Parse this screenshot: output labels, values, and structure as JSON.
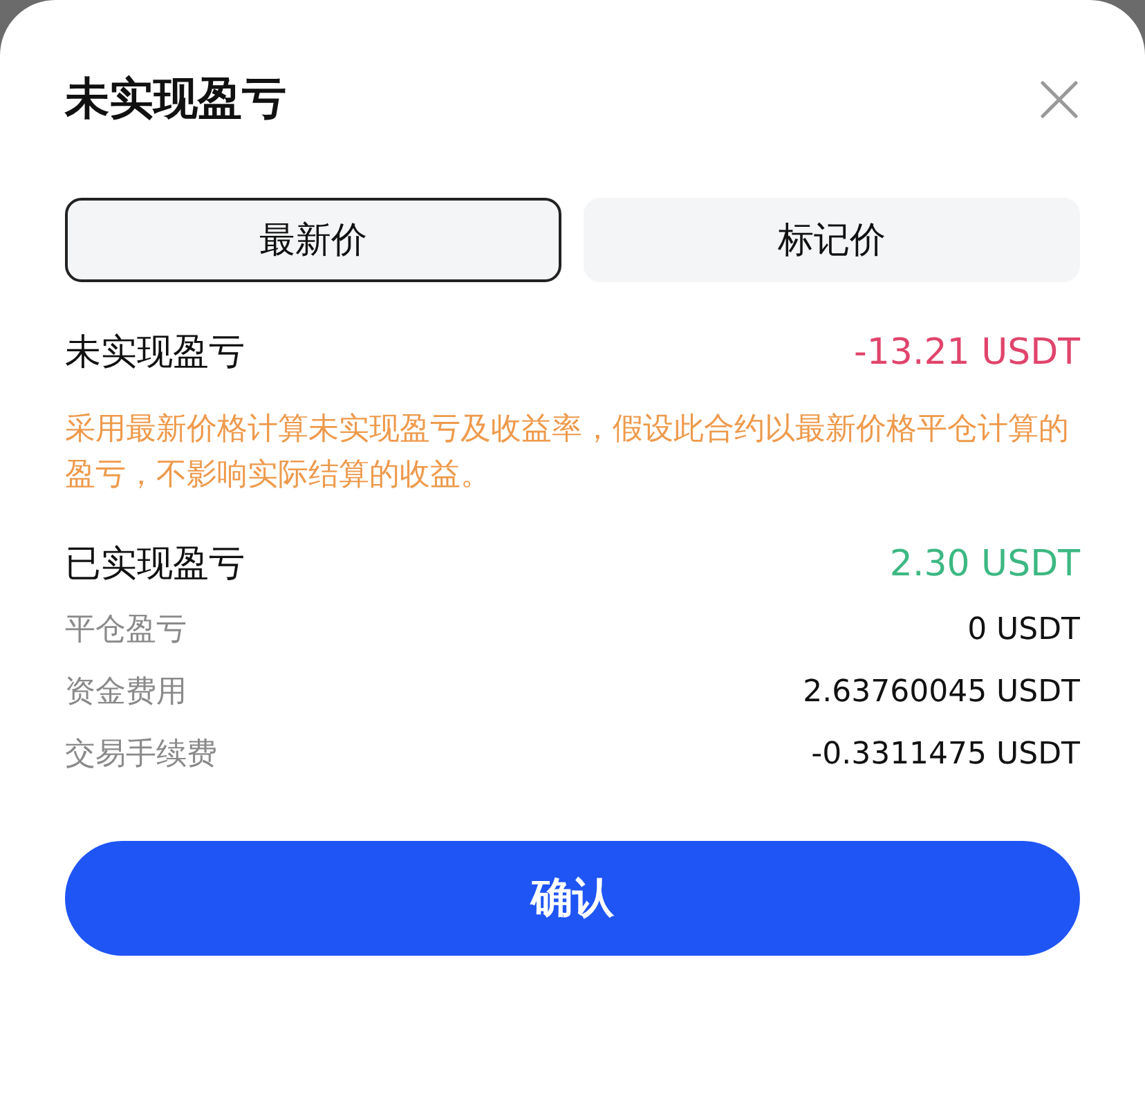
{
  "title": "未实现盈亏",
  "tabs": [
    {
      "label": "最新价",
      "selected": true
    },
    {
      "label": "标记价",
      "selected": false
    }
  ],
  "unrealized": {
    "label": "未实现盈亏",
    "value": "-13.21 USDT",
    "color": "#e0446c"
  },
  "note": "采用最新价格计算未实现盈亏及收益率，假设此合约以最新价格平仓计算的盈亏，不影响实际结算的收益。",
  "realized": {
    "label": "已实现盈亏",
    "value": "2.30 USDT",
    "color": "#3db883"
  },
  "details": [
    {
      "label": "平仓盈亏",
      "value": "0 USDT"
    },
    {
      "label": "资金费用",
      "value": "2.63760045 USDT"
    },
    {
      "label": "交易手续费",
      "value": "-0.3311475 USDT"
    }
  ],
  "confirm": "确认"
}
